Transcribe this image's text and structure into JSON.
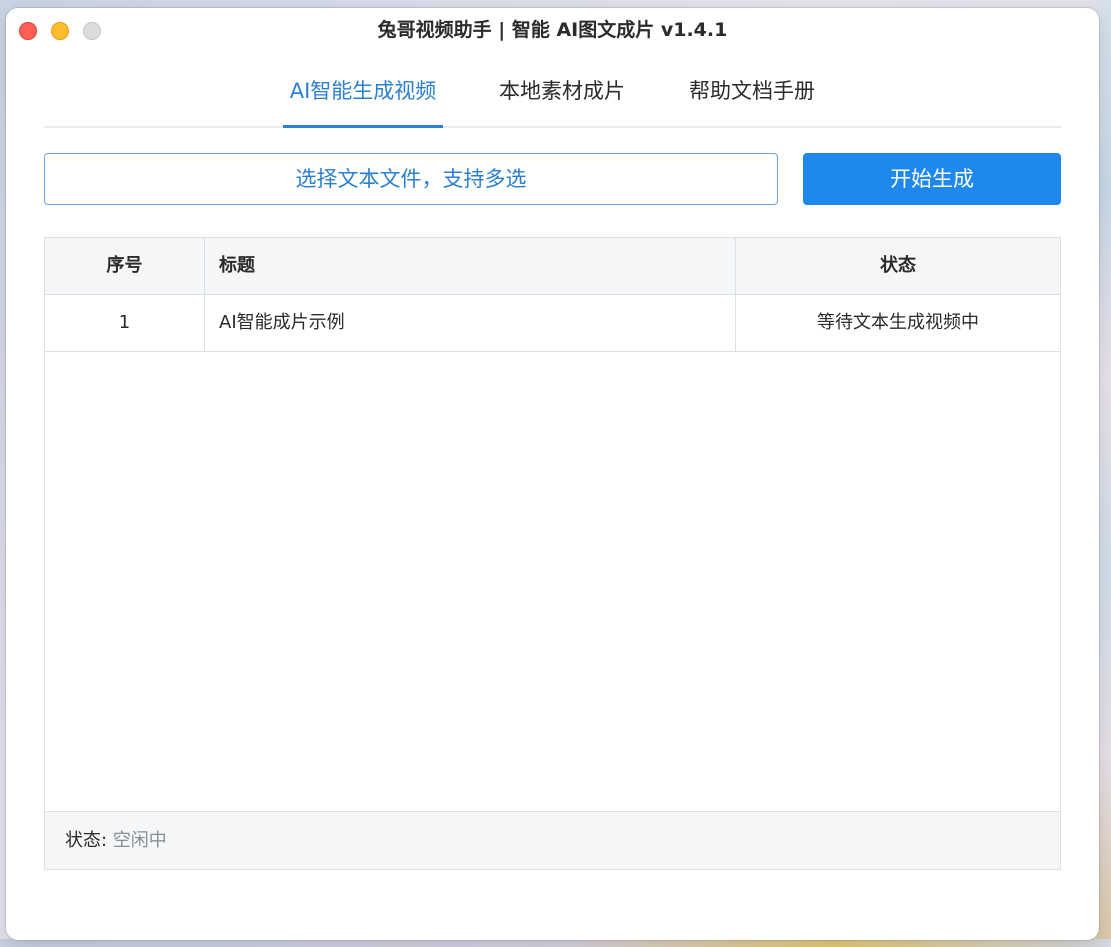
{
  "window": {
    "title": "兔哥视频助手 | 智能 AI图文成片 v1.4.1"
  },
  "tabs": [
    {
      "label": "AI智能生成视频",
      "active": true
    },
    {
      "label": "本地素材成片",
      "active": false
    },
    {
      "label": "帮助文档手册",
      "active": false
    }
  ],
  "toolbar": {
    "select_label": "选择文本文件，支持多选",
    "start_label": "开始生成"
  },
  "table": {
    "columns": [
      "序号",
      "标题",
      "状态"
    ],
    "rows": [
      {
        "index": "1",
        "title": "AI智能成片示例",
        "status": "等待文本生成视频中"
      }
    ]
  },
  "statusbar": {
    "label": "状态:",
    "value": "空闲中"
  },
  "colors": {
    "accent": "#2b7fd0",
    "primary_button": "#1f88ef"
  }
}
